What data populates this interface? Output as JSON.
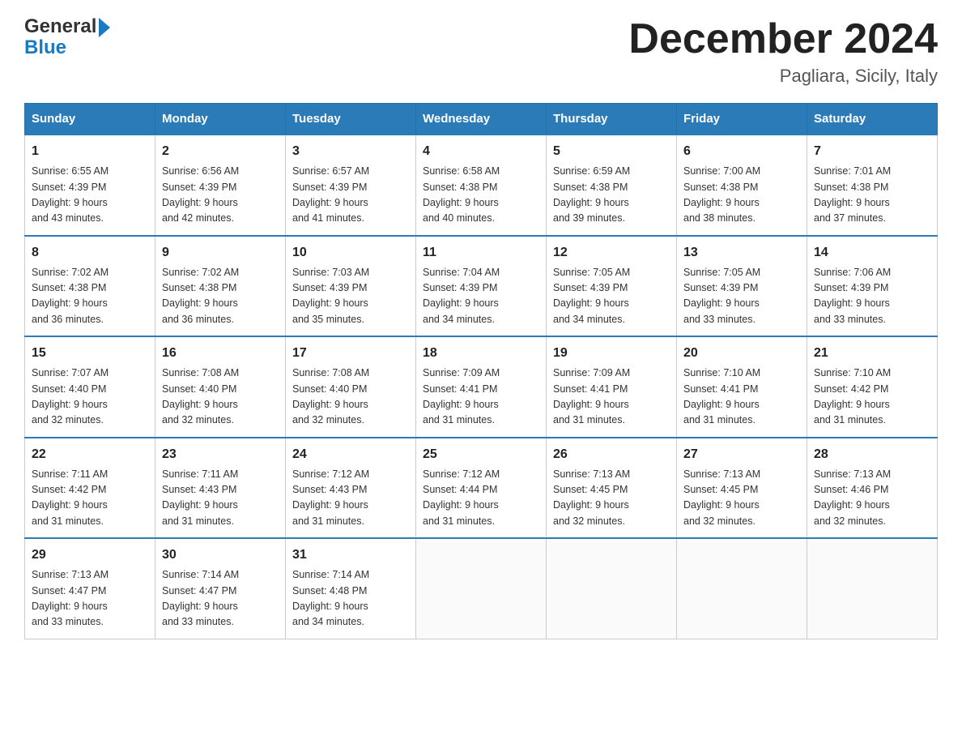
{
  "header": {
    "logo_general": "General",
    "logo_blue": "Blue",
    "month_title": "December 2024",
    "location": "Pagliara, Sicily, Italy"
  },
  "days_of_week": [
    "Sunday",
    "Monday",
    "Tuesday",
    "Wednesday",
    "Thursday",
    "Friday",
    "Saturday"
  ],
  "weeks": [
    [
      {
        "day": "1",
        "sunrise": "Sunrise: 6:55 AM",
        "sunset": "Sunset: 4:39 PM",
        "daylight": "Daylight: 9 hours and 43 minutes."
      },
      {
        "day": "2",
        "sunrise": "Sunrise: 6:56 AM",
        "sunset": "Sunset: 4:39 PM",
        "daylight": "Daylight: 9 hours and 42 minutes."
      },
      {
        "day": "3",
        "sunrise": "Sunrise: 6:57 AM",
        "sunset": "Sunset: 4:39 PM",
        "daylight": "Daylight: 9 hours and 41 minutes."
      },
      {
        "day": "4",
        "sunrise": "Sunrise: 6:58 AM",
        "sunset": "Sunset: 4:38 PM",
        "daylight": "Daylight: 9 hours and 40 minutes."
      },
      {
        "day": "5",
        "sunrise": "Sunrise: 6:59 AM",
        "sunset": "Sunset: 4:38 PM",
        "daylight": "Daylight: 9 hours and 39 minutes."
      },
      {
        "day": "6",
        "sunrise": "Sunrise: 7:00 AM",
        "sunset": "Sunset: 4:38 PM",
        "daylight": "Daylight: 9 hours and 38 minutes."
      },
      {
        "day": "7",
        "sunrise": "Sunrise: 7:01 AM",
        "sunset": "Sunset: 4:38 PM",
        "daylight": "Daylight: 9 hours and 37 minutes."
      }
    ],
    [
      {
        "day": "8",
        "sunrise": "Sunrise: 7:02 AM",
        "sunset": "Sunset: 4:38 PM",
        "daylight": "Daylight: 9 hours and 36 minutes."
      },
      {
        "day": "9",
        "sunrise": "Sunrise: 7:02 AM",
        "sunset": "Sunset: 4:38 PM",
        "daylight": "Daylight: 9 hours and 36 minutes."
      },
      {
        "day": "10",
        "sunrise": "Sunrise: 7:03 AM",
        "sunset": "Sunset: 4:39 PM",
        "daylight": "Daylight: 9 hours and 35 minutes."
      },
      {
        "day": "11",
        "sunrise": "Sunrise: 7:04 AM",
        "sunset": "Sunset: 4:39 PM",
        "daylight": "Daylight: 9 hours and 34 minutes."
      },
      {
        "day": "12",
        "sunrise": "Sunrise: 7:05 AM",
        "sunset": "Sunset: 4:39 PM",
        "daylight": "Daylight: 9 hours and 34 minutes."
      },
      {
        "day": "13",
        "sunrise": "Sunrise: 7:05 AM",
        "sunset": "Sunset: 4:39 PM",
        "daylight": "Daylight: 9 hours and 33 minutes."
      },
      {
        "day": "14",
        "sunrise": "Sunrise: 7:06 AM",
        "sunset": "Sunset: 4:39 PM",
        "daylight": "Daylight: 9 hours and 33 minutes."
      }
    ],
    [
      {
        "day": "15",
        "sunrise": "Sunrise: 7:07 AM",
        "sunset": "Sunset: 4:40 PM",
        "daylight": "Daylight: 9 hours and 32 minutes."
      },
      {
        "day": "16",
        "sunrise": "Sunrise: 7:08 AM",
        "sunset": "Sunset: 4:40 PM",
        "daylight": "Daylight: 9 hours and 32 minutes."
      },
      {
        "day": "17",
        "sunrise": "Sunrise: 7:08 AM",
        "sunset": "Sunset: 4:40 PM",
        "daylight": "Daylight: 9 hours and 32 minutes."
      },
      {
        "day": "18",
        "sunrise": "Sunrise: 7:09 AM",
        "sunset": "Sunset: 4:41 PM",
        "daylight": "Daylight: 9 hours and 31 minutes."
      },
      {
        "day": "19",
        "sunrise": "Sunrise: 7:09 AM",
        "sunset": "Sunset: 4:41 PM",
        "daylight": "Daylight: 9 hours and 31 minutes."
      },
      {
        "day": "20",
        "sunrise": "Sunrise: 7:10 AM",
        "sunset": "Sunset: 4:41 PM",
        "daylight": "Daylight: 9 hours and 31 minutes."
      },
      {
        "day": "21",
        "sunrise": "Sunrise: 7:10 AM",
        "sunset": "Sunset: 4:42 PM",
        "daylight": "Daylight: 9 hours and 31 minutes."
      }
    ],
    [
      {
        "day": "22",
        "sunrise": "Sunrise: 7:11 AM",
        "sunset": "Sunset: 4:42 PM",
        "daylight": "Daylight: 9 hours and 31 minutes."
      },
      {
        "day": "23",
        "sunrise": "Sunrise: 7:11 AM",
        "sunset": "Sunset: 4:43 PM",
        "daylight": "Daylight: 9 hours and 31 minutes."
      },
      {
        "day": "24",
        "sunrise": "Sunrise: 7:12 AM",
        "sunset": "Sunset: 4:43 PM",
        "daylight": "Daylight: 9 hours and 31 minutes."
      },
      {
        "day": "25",
        "sunrise": "Sunrise: 7:12 AM",
        "sunset": "Sunset: 4:44 PM",
        "daylight": "Daylight: 9 hours and 31 minutes."
      },
      {
        "day": "26",
        "sunrise": "Sunrise: 7:13 AM",
        "sunset": "Sunset: 4:45 PM",
        "daylight": "Daylight: 9 hours and 32 minutes."
      },
      {
        "day": "27",
        "sunrise": "Sunrise: 7:13 AM",
        "sunset": "Sunset: 4:45 PM",
        "daylight": "Daylight: 9 hours and 32 minutes."
      },
      {
        "day": "28",
        "sunrise": "Sunrise: 7:13 AM",
        "sunset": "Sunset: 4:46 PM",
        "daylight": "Daylight: 9 hours and 32 minutes."
      }
    ],
    [
      {
        "day": "29",
        "sunrise": "Sunrise: 7:13 AM",
        "sunset": "Sunset: 4:47 PM",
        "daylight": "Daylight: 9 hours and 33 minutes."
      },
      {
        "day": "30",
        "sunrise": "Sunrise: 7:14 AM",
        "sunset": "Sunset: 4:47 PM",
        "daylight": "Daylight: 9 hours and 33 minutes."
      },
      {
        "day": "31",
        "sunrise": "Sunrise: 7:14 AM",
        "sunset": "Sunset: 4:48 PM",
        "daylight": "Daylight: 9 hours and 34 minutes."
      },
      null,
      null,
      null,
      null
    ]
  ]
}
